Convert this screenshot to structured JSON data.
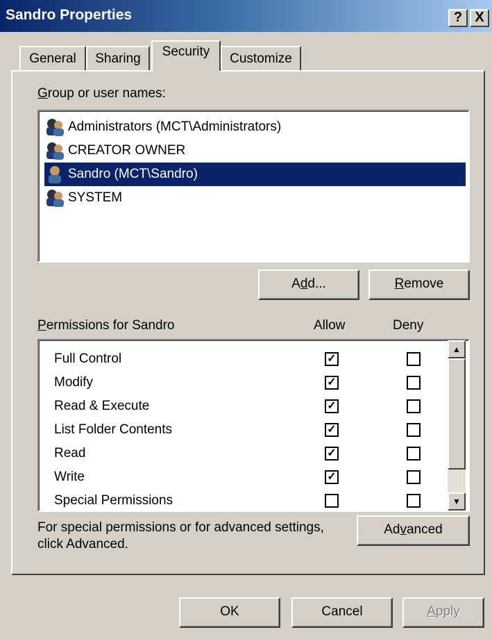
{
  "window": {
    "title": "Sandro Properties",
    "help_label": "?",
    "close_label": "X"
  },
  "tabs": [
    {
      "label": "General",
      "active": false
    },
    {
      "label": "Sharing",
      "active": false
    },
    {
      "label": "Security",
      "active": true
    },
    {
      "label": "Customize",
      "active": false
    }
  ],
  "groups": {
    "label_mnemonic": "G",
    "label_rest": "roup or user names:",
    "items": [
      {
        "name": "Administrators (MCT\\Administrators)",
        "icon": "group-users-icon",
        "selected": false
      },
      {
        "name": "CREATOR OWNER",
        "icon": "group-users-icon",
        "selected": false
      },
      {
        "name": "Sandro (MCT\\Sandro)",
        "icon": "user-icon",
        "selected": true
      },
      {
        "name": "SYSTEM",
        "icon": "group-users-icon",
        "selected": false
      }
    ]
  },
  "buttons": {
    "add_pre": "A",
    "add_mn": "d",
    "add_post": "d...",
    "remove_mn": "R",
    "remove_post": "emove",
    "advanced_pre": "Ad",
    "advanced_mn": "v",
    "advanced_post": "anced",
    "ok": "OK",
    "cancel": "Cancel",
    "apply_mn": "A",
    "apply_post": "pply"
  },
  "permissions": {
    "label_mnemonic": "P",
    "label_rest": "ermissions for Sandro",
    "allow_header": "Allow",
    "deny_header": "Deny",
    "rows": [
      {
        "name": "Full Control",
        "allow": true,
        "deny": false
      },
      {
        "name": "Modify",
        "allow": true,
        "deny": false
      },
      {
        "name": "Read & Execute",
        "allow": true,
        "deny": false
      },
      {
        "name": "List Folder Contents",
        "allow": true,
        "deny": false
      },
      {
        "name": "Read",
        "allow": true,
        "deny": false
      },
      {
        "name": "Write",
        "allow": true,
        "deny": false
      },
      {
        "name": "Special Permissions",
        "allow": false,
        "deny": false
      }
    ]
  },
  "advanced_note": {
    "line1": "For special permissions or for advanced settings,",
    "line2": "click Advanced."
  },
  "colors": {
    "selection": "#0a246a",
    "face": "#d4d0c8"
  }
}
